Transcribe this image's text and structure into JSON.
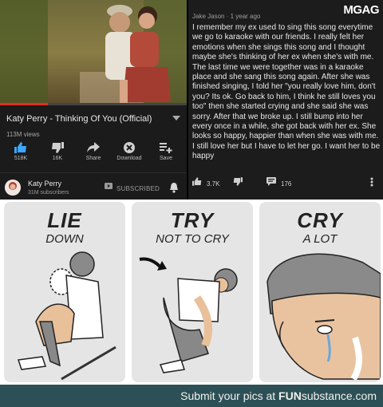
{
  "video": {
    "title": "Katy Perry - Thinking Of You (Official)",
    "views": "113M views",
    "actions": [
      {
        "icon": "thumbs-up-icon",
        "label": "518K"
      },
      {
        "icon": "thumbs-down-icon",
        "label": "16K"
      },
      {
        "icon": "share-icon",
        "label": "Share"
      },
      {
        "icon": "download-icon",
        "label": "Download"
      },
      {
        "icon": "save-playlist-icon",
        "label": "Save"
      }
    ],
    "channel": {
      "name": "Katy Perry",
      "subscribers": "31M subscribers",
      "subscribe_state": "SUBSCRIBED"
    }
  },
  "comment": {
    "author_line": "Jake Jason · 1 year ago",
    "text": "I remember my ex used to sing this song everytime we go to karaoke with our friends. I really felt her emotions when she sings this song and I thought maybe she's thinking of her ex when she's with me. The last time we were together was in a karaoke place and she sang this song again. After she was finished singing, I told her \"you really love him, don't you? Its ok. Go back to him, I think he still loves you too\" then she started crying and she said she was sorry. After that we broke up. I still bump into her every once in a while, she got back with her ex. She looks so happy, happier than when she was with me. I still love her but I have to let her go. I want her to be happy",
    "likes": "3.7K",
    "replies": "176"
  },
  "brand": {
    "logo": "MGAG"
  },
  "meme": {
    "panels": [
      {
        "big": "LIE",
        "small": "DOWN"
      },
      {
        "big": "TRY",
        "small": "NOT TO CRY"
      },
      {
        "big": "CRY",
        "small": "A LOT"
      }
    ]
  },
  "footer": {
    "prefix": "Submit your pics at ",
    "site_bold": "FUN",
    "site_rest": "substance.com"
  },
  "colors": {
    "youtube_red": "#e52d27",
    "like_blue": "#3ea6ff",
    "footer_bg": "#2c5055"
  }
}
